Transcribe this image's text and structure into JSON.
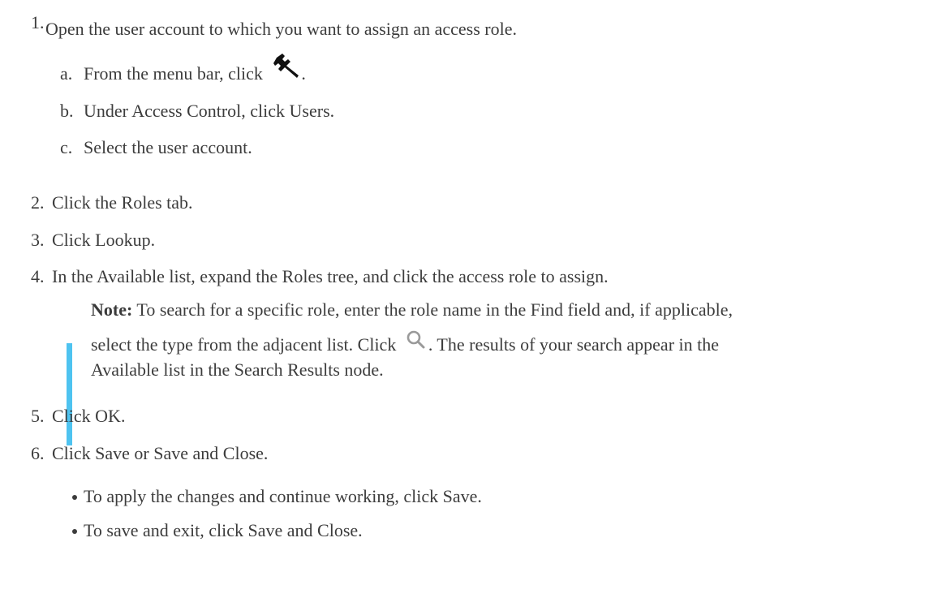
{
  "steps": [
    {
      "num": "1.",
      "text": "Open the user account to which you want to assign an access role."
    },
    {
      "num": "2.",
      "text": "Click the Roles tab."
    },
    {
      "num": "3.",
      "text": "Click Lookup."
    },
    {
      "num": "4.",
      "text": "In the Available list, expand the Roles tree, and click the access role to assign."
    },
    {
      "num": "5.",
      "text": "Click OK."
    },
    {
      "num": "6.",
      "text": "Click Save or Save and Close."
    }
  ],
  "substeps": [
    {
      "letter": "a.",
      "text_before_icon": "From the menu bar, click",
      "text_after_icon": ".",
      "icon": "wrench-icon"
    },
    {
      "letter": "b.",
      "text": "Under Access Control, click Users."
    },
    {
      "letter": "c.",
      "text": "Select the user account."
    }
  ],
  "note": {
    "label": "Note:",
    "line1": "To search for a specific role, enter the role name in the Find field and, if applicable,",
    "line2_before_icon": "select the type from the adjacent list. Click",
    "line2_after_icon": ". The results of your search appear in the",
    "line3": "Available list in the Search Results node.",
    "icon": "search-icon",
    "accent_color": "#4ec3f0"
  },
  "bullets": [
    "To apply the changes and continue working, click Save.",
    "To save and exit, click Save and Close."
  ]
}
